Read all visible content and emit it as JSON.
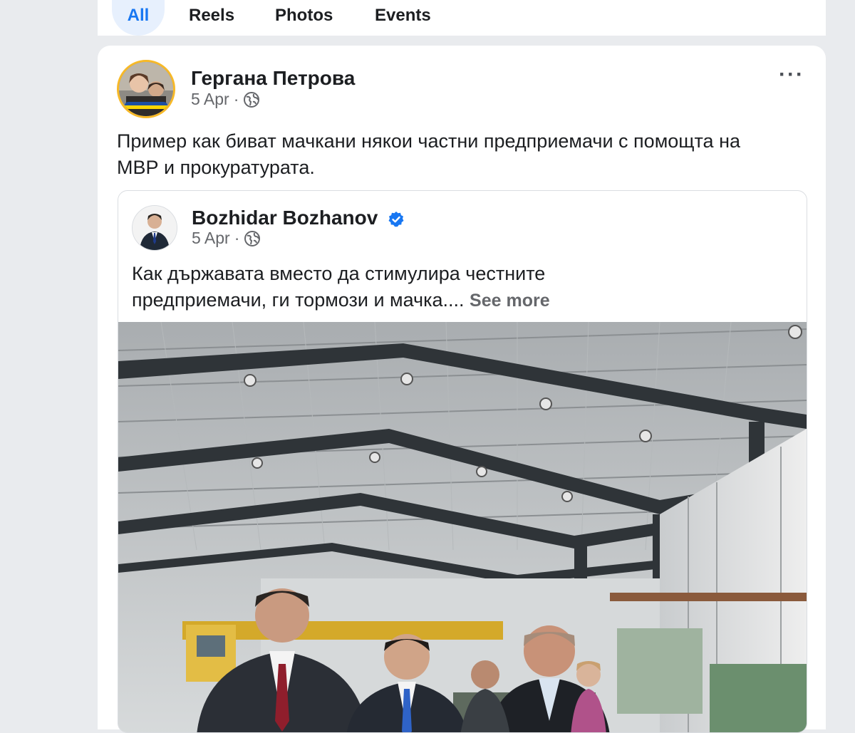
{
  "tabs": [
    {
      "label": "All",
      "active": true
    },
    {
      "label": "Reels",
      "active": false
    },
    {
      "label": "Photos",
      "active": false
    },
    {
      "label": "Events",
      "active": false
    }
  ],
  "post": {
    "author": "Гергана Петрова",
    "date": "5 Apr",
    "separator": "·",
    "audience_icon": "globe-icon",
    "menu_label": "···",
    "text": "Пример как биват мачкани някои частни предприемачи с помощта на МВР и прокуратурата.",
    "avatar_badge": "#StandWithUkraine"
  },
  "shared_post": {
    "author": "Bozhidar Bozhanov",
    "verified": true,
    "date": "5 Apr",
    "separator": "·",
    "audience_icon": "globe-icon",
    "text": "Как държавата вместо да стимулира честните предприемачи, ги тормози и мачка....",
    "see_more": "See more",
    "photo_description_icon": "factory-hall-photo"
  },
  "colors": {
    "accent": "#1877f2",
    "text": "#1c1e21",
    "secondary_text": "#65676b",
    "avatar_ring": "#f7b928"
  }
}
